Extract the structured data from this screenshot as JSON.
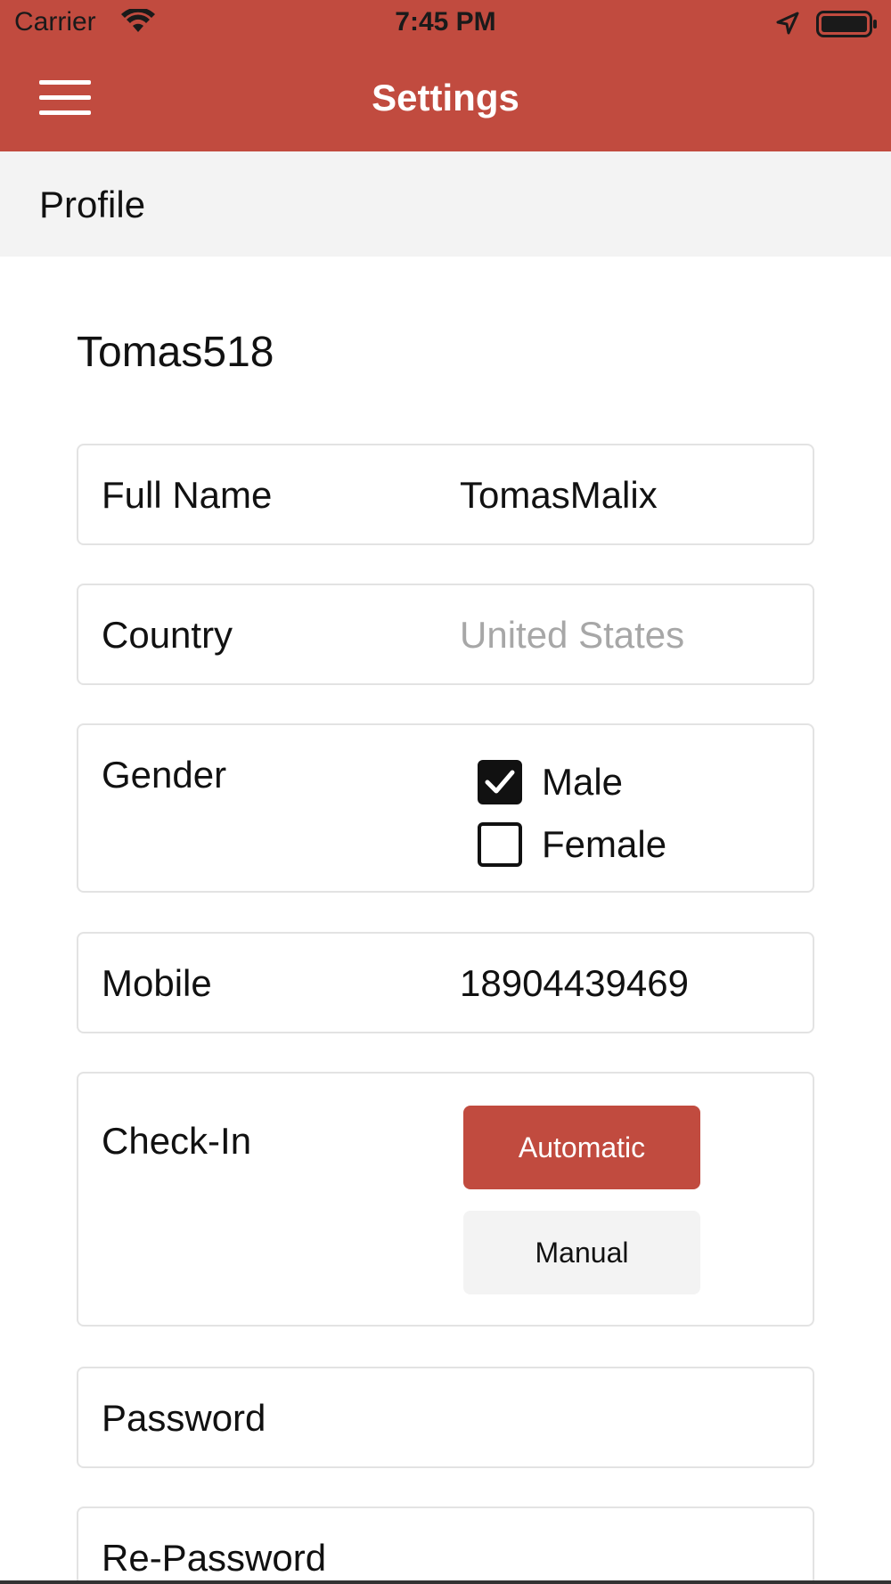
{
  "status_bar": {
    "carrier": "Carrier",
    "time": "7:45 PM"
  },
  "header": {
    "title": "Settings",
    "menu_icon": "hamburger-menu-icon",
    "background": "#c14b3f"
  },
  "section": {
    "title": "Profile"
  },
  "profile": {
    "username": "Tomas518",
    "full_name": {
      "label": "Full Name",
      "value": "TomasMalix"
    },
    "country": {
      "label": "Country",
      "placeholder": "United States"
    },
    "gender": {
      "label": "Gender",
      "options": [
        {
          "label": "Male",
          "checked": true
        },
        {
          "label": "Female",
          "checked": false
        }
      ]
    },
    "mobile": {
      "label": "Mobile",
      "value": "18904439469"
    },
    "check_in": {
      "label": "Check-In",
      "options": [
        {
          "label": "Automatic",
          "selected": true
        },
        {
          "label": "Manual",
          "selected": false
        }
      ]
    },
    "password": {
      "label": "Password"
    },
    "re_password": {
      "label": "Re-Password"
    }
  },
  "colors": {
    "accent": "#c14b3f",
    "section_bg": "#f3f3f3",
    "placeholder": "#a7a7a7"
  }
}
